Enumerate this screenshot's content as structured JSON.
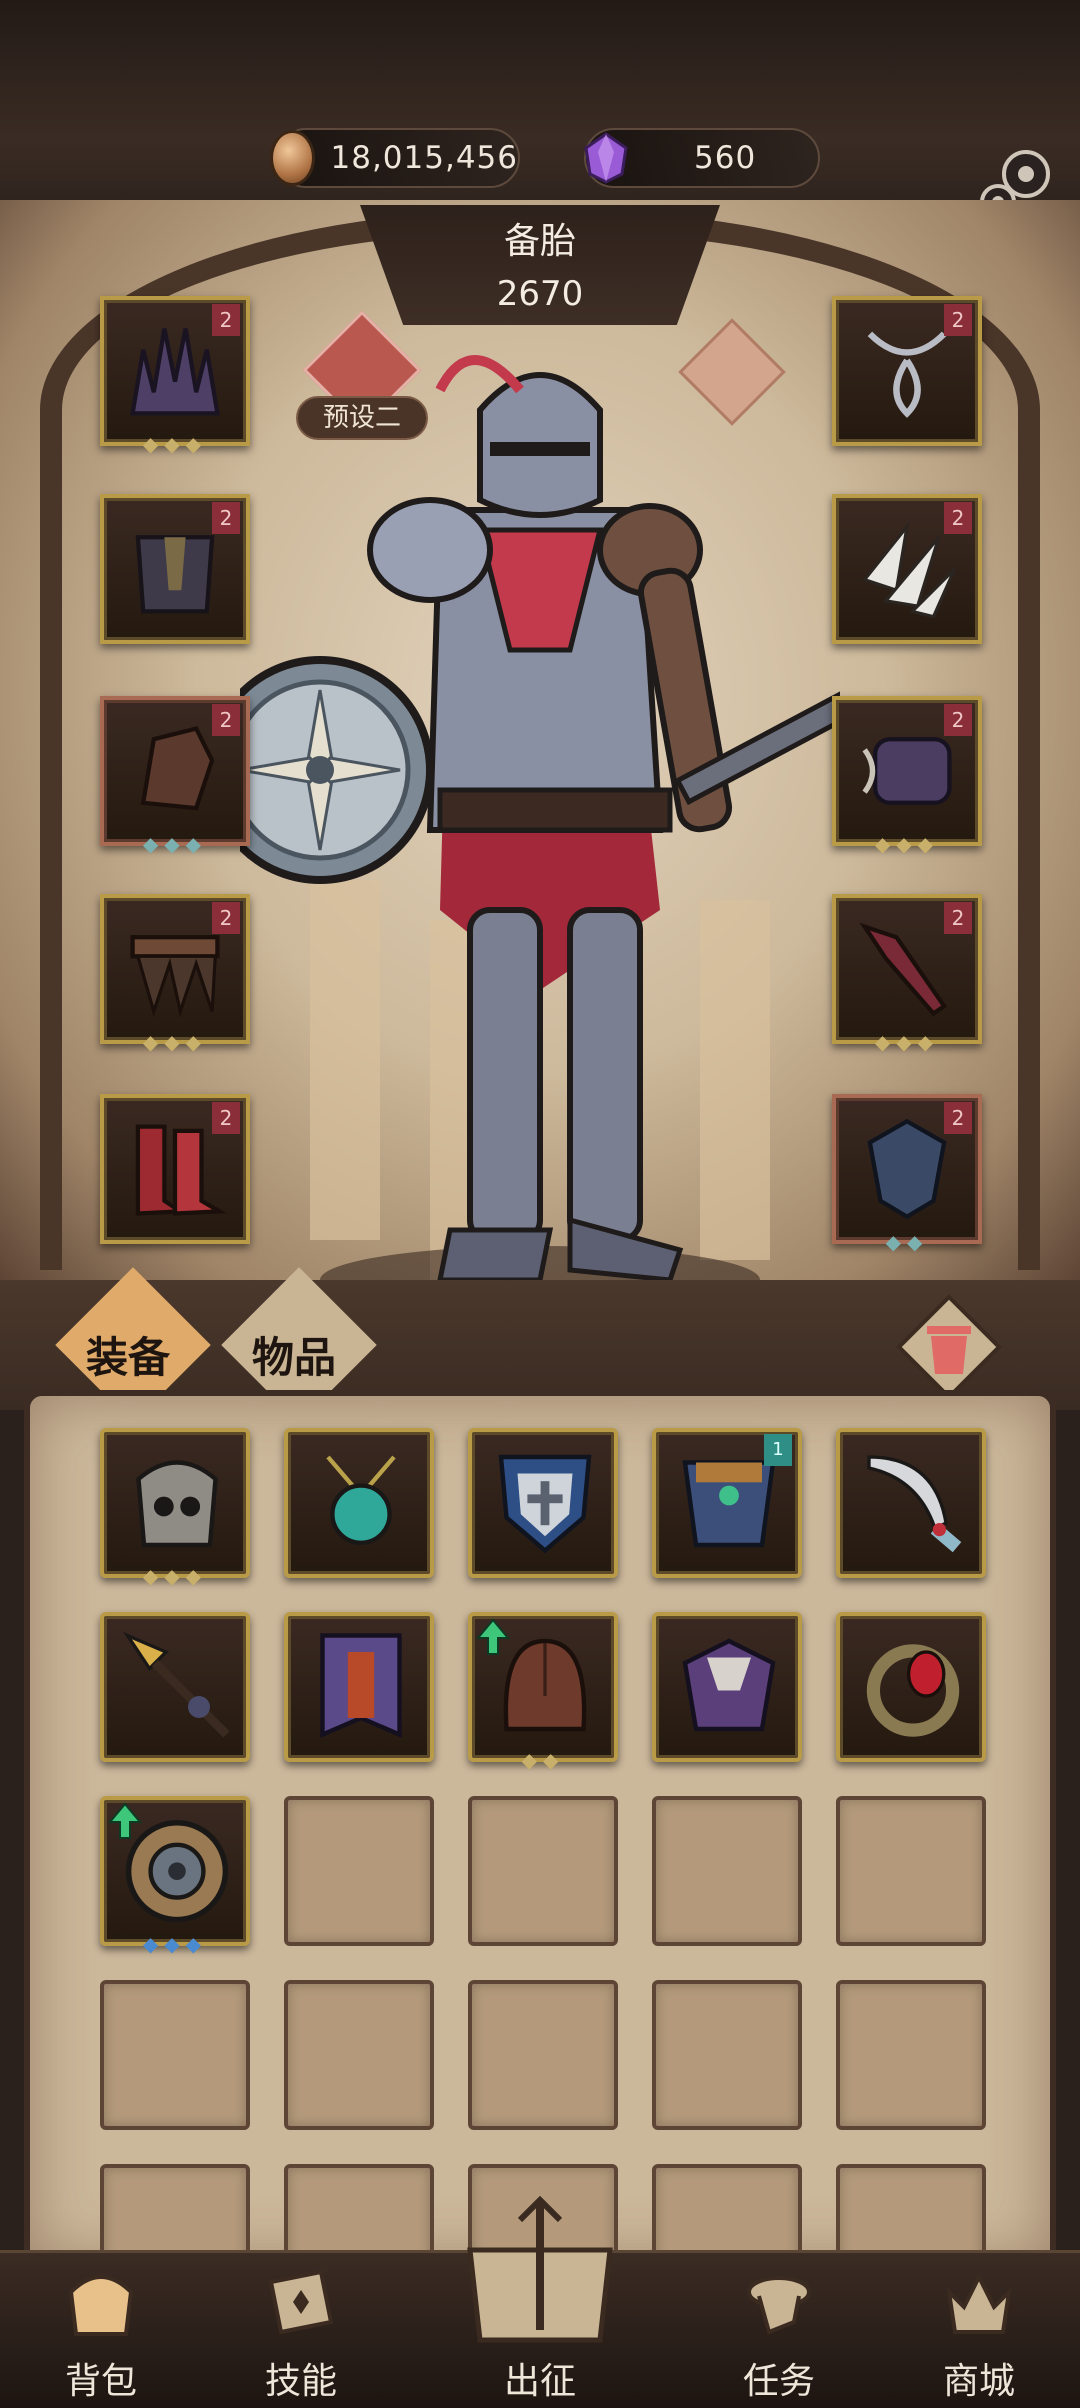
{
  "resources": {
    "coins": "18,015,456",
    "gems": "560",
    "coin_icon": "coin-icon",
    "gem_icon": "purple-gem-icon"
  },
  "settings_icon": "gear-icon",
  "character": {
    "name": "备胎",
    "power": "2670",
    "preset_label": "预设二",
    "preset_icon": "crest-icon",
    "stat_icon": "figure-icon"
  },
  "equipment": {
    "left": [
      {
        "slot": "helmet",
        "level": "2",
        "frame": "gold"
      },
      {
        "slot": "armor",
        "level": "2",
        "frame": "gold"
      },
      {
        "slot": "gloves",
        "level": "2",
        "frame": "red"
      },
      {
        "slot": "belt",
        "level": "2",
        "frame": "gold"
      },
      {
        "slot": "boots",
        "level": "2",
        "frame": "gold"
      }
    ],
    "right": [
      {
        "slot": "necklace",
        "level": "2",
        "frame": "gold"
      },
      {
        "slot": "cape",
        "level": "2",
        "frame": "gold"
      },
      {
        "slot": "bracer",
        "level": "2",
        "frame": "gold"
      },
      {
        "slot": "weapon",
        "level": "2",
        "frame": "gold"
      },
      {
        "slot": "shield",
        "level": "2",
        "frame": "red"
      }
    ]
  },
  "inventory": {
    "tabs": [
      "装备",
      "物品"
    ],
    "trash_icon": "trash-icon",
    "items": [
      {
        "name": "skull-helm",
        "upgrade": false
      },
      {
        "name": "emerald-amulet",
        "upgrade": false
      },
      {
        "name": "cross-shield",
        "upgrade": false
      },
      {
        "name": "jeweled-chestplate",
        "upgrade": false,
        "badge": "1"
      },
      {
        "name": "curved-dagger",
        "upgrade": false
      },
      {
        "name": "golden-spear",
        "upgrade": false
      },
      {
        "name": "rune-banner",
        "upgrade": false
      },
      {
        "name": "leather-hood",
        "upgrade": true
      },
      {
        "name": "beast-skull-armor",
        "upgrade": false
      },
      {
        "name": "ruby-ring",
        "upgrade": false
      },
      {
        "name": "round-shield",
        "upgrade": true
      }
    ],
    "total_cells": 25
  },
  "nav": {
    "items": [
      "背包",
      "技能",
      "出征",
      "任务",
      "商城"
    ]
  }
}
